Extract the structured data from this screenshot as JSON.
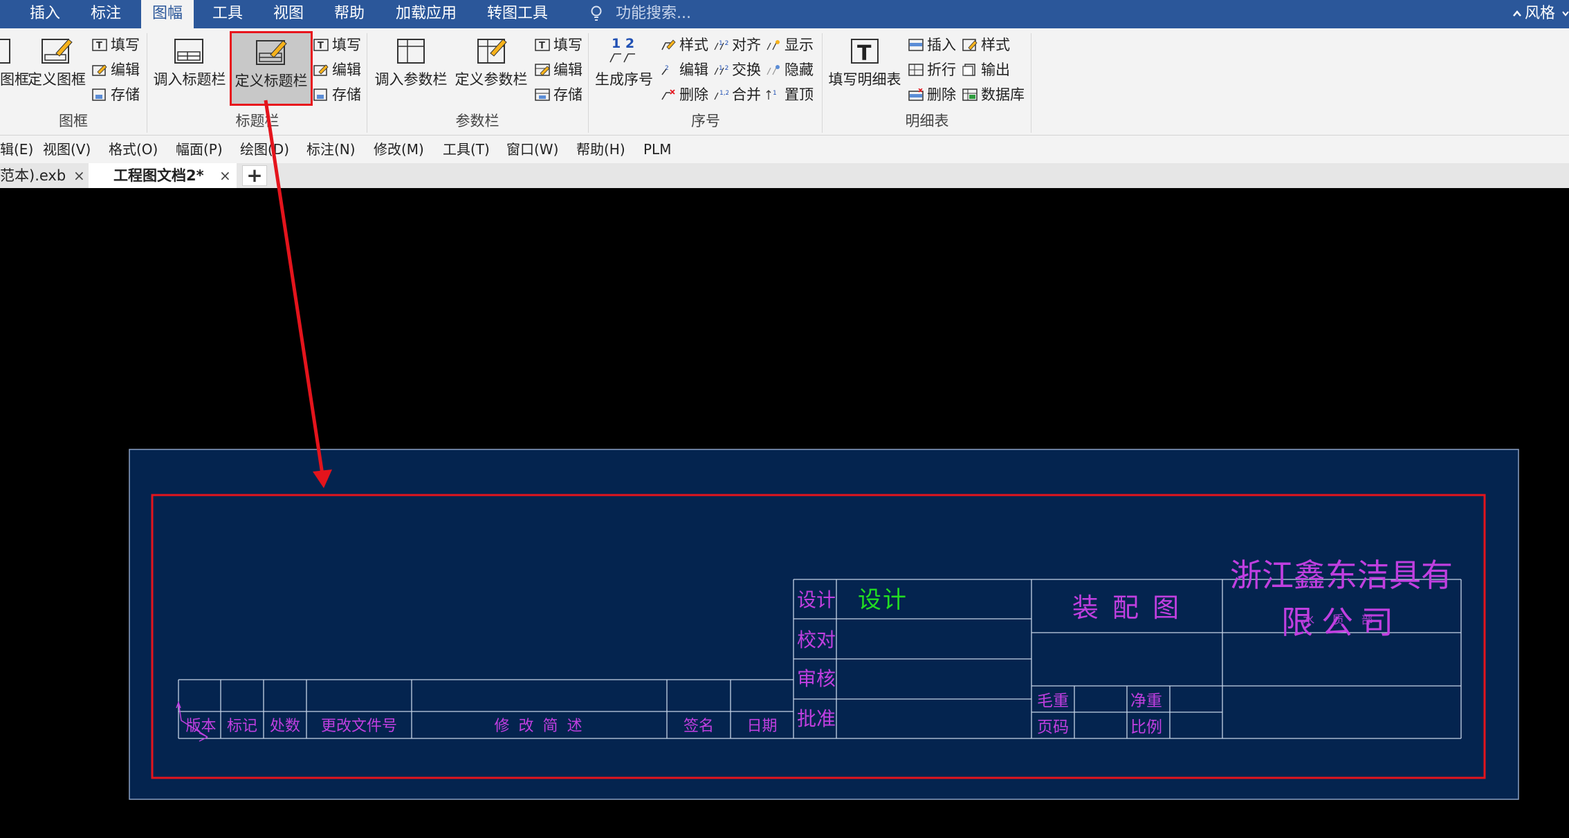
{
  "ribbon_tabs": [
    {
      "label": "插入"
    },
    {
      "label": "标注"
    },
    {
      "label": "图幅",
      "active": true
    },
    {
      "label": "工具"
    },
    {
      "label": "视图"
    },
    {
      "label": "帮助"
    },
    {
      "label": "加载应用"
    },
    {
      "label": "转图工具"
    }
  ],
  "search": {
    "placeholder": "功能搜索..."
  },
  "top_right": {
    "collapse_icon": "caret-up-icon",
    "style_label": "风格"
  },
  "groups": {
    "frame": {
      "label": "图框",
      "btn_partial": "图框",
      "btn_define": "定义图框",
      "fill": "填写",
      "edit": "编辑",
      "save": "存储"
    },
    "titlebar": {
      "label": "标题栏",
      "btn_load": "调入标题栏",
      "btn_define": "定义标题栏",
      "fill": "填写",
      "edit": "编辑",
      "save": "存储"
    },
    "parambar": {
      "label": "参数栏",
      "btn_load": "调入参数栏",
      "btn_define": "定义参数栏",
      "fill": "填写",
      "edit": "编辑",
      "save": "存储"
    },
    "seq": {
      "label": "序号",
      "icon_text": "1 2",
      "btn_gen": "生成序号",
      "style": "样式",
      "edit": "编辑",
      "delete": "删除",
      "align": "对齐",
      "swap": "交换",
      "merge": "合并",
      "show": "显示",
      "hide": "隐藏",
      "top": "置顶"
    },
    "bom": {
      "label": "明细表",
      "btn_fill": "填写明细表",
      "insert": "插入",
      "fold": "折行",
      "delete": "删除",
      "style": "样式",
      "export": "输出",
      "db": "数据库"
    }
  },
  "menubar": [
    "辑(E)",
    "视图(V)",
    "格式(O)",
    "幅面(P)",
    "绘图(D)",
    "标注(N)",
    "修改(M)",
    "工具(T)",
    "窗口(W)",
    "帮助(H)",
    "PLM"
  ],
  "doc_tabs": [
    {
      "label": "范本).exb",
      "close": "×"
    },
    {
      "label": "工程图文档2*",
      "close": "×",
      "active": true
    }
  ],
  "new_tab": "+",
  "drawing": {
    "colors": {
      "sheet_bg": "#04244f",
      "line": "#c7d3e6",
      "magenta": "#c03fe0",
      "green": "#22dd22",
      "red": "#e4141c",
      "blue": "#2c49e0"
    },
    "title_block": {
      "design": "设计",
      "check": "校对",
      "review": "审核",
      "approve": "批准",
      "design_value": "设计",
      "drawing_name": "装 配 图",
      "company_line1": "浙江鑫东洁具有",
      "company_line2": "限公司",
      "company_overlap": "水 质 部",
      "gross_weight": "毛重",
      "net_weight": "净重",
      "page": "页码",
      "scale": "比例"
    },
    "revision_table": {
      "headers": [
        "版本",
        "标记",
        "处数",
        "更改文件号",
        "修 改 简 述",
        "签名",
        "日期"
      ]
    }
  }
}
